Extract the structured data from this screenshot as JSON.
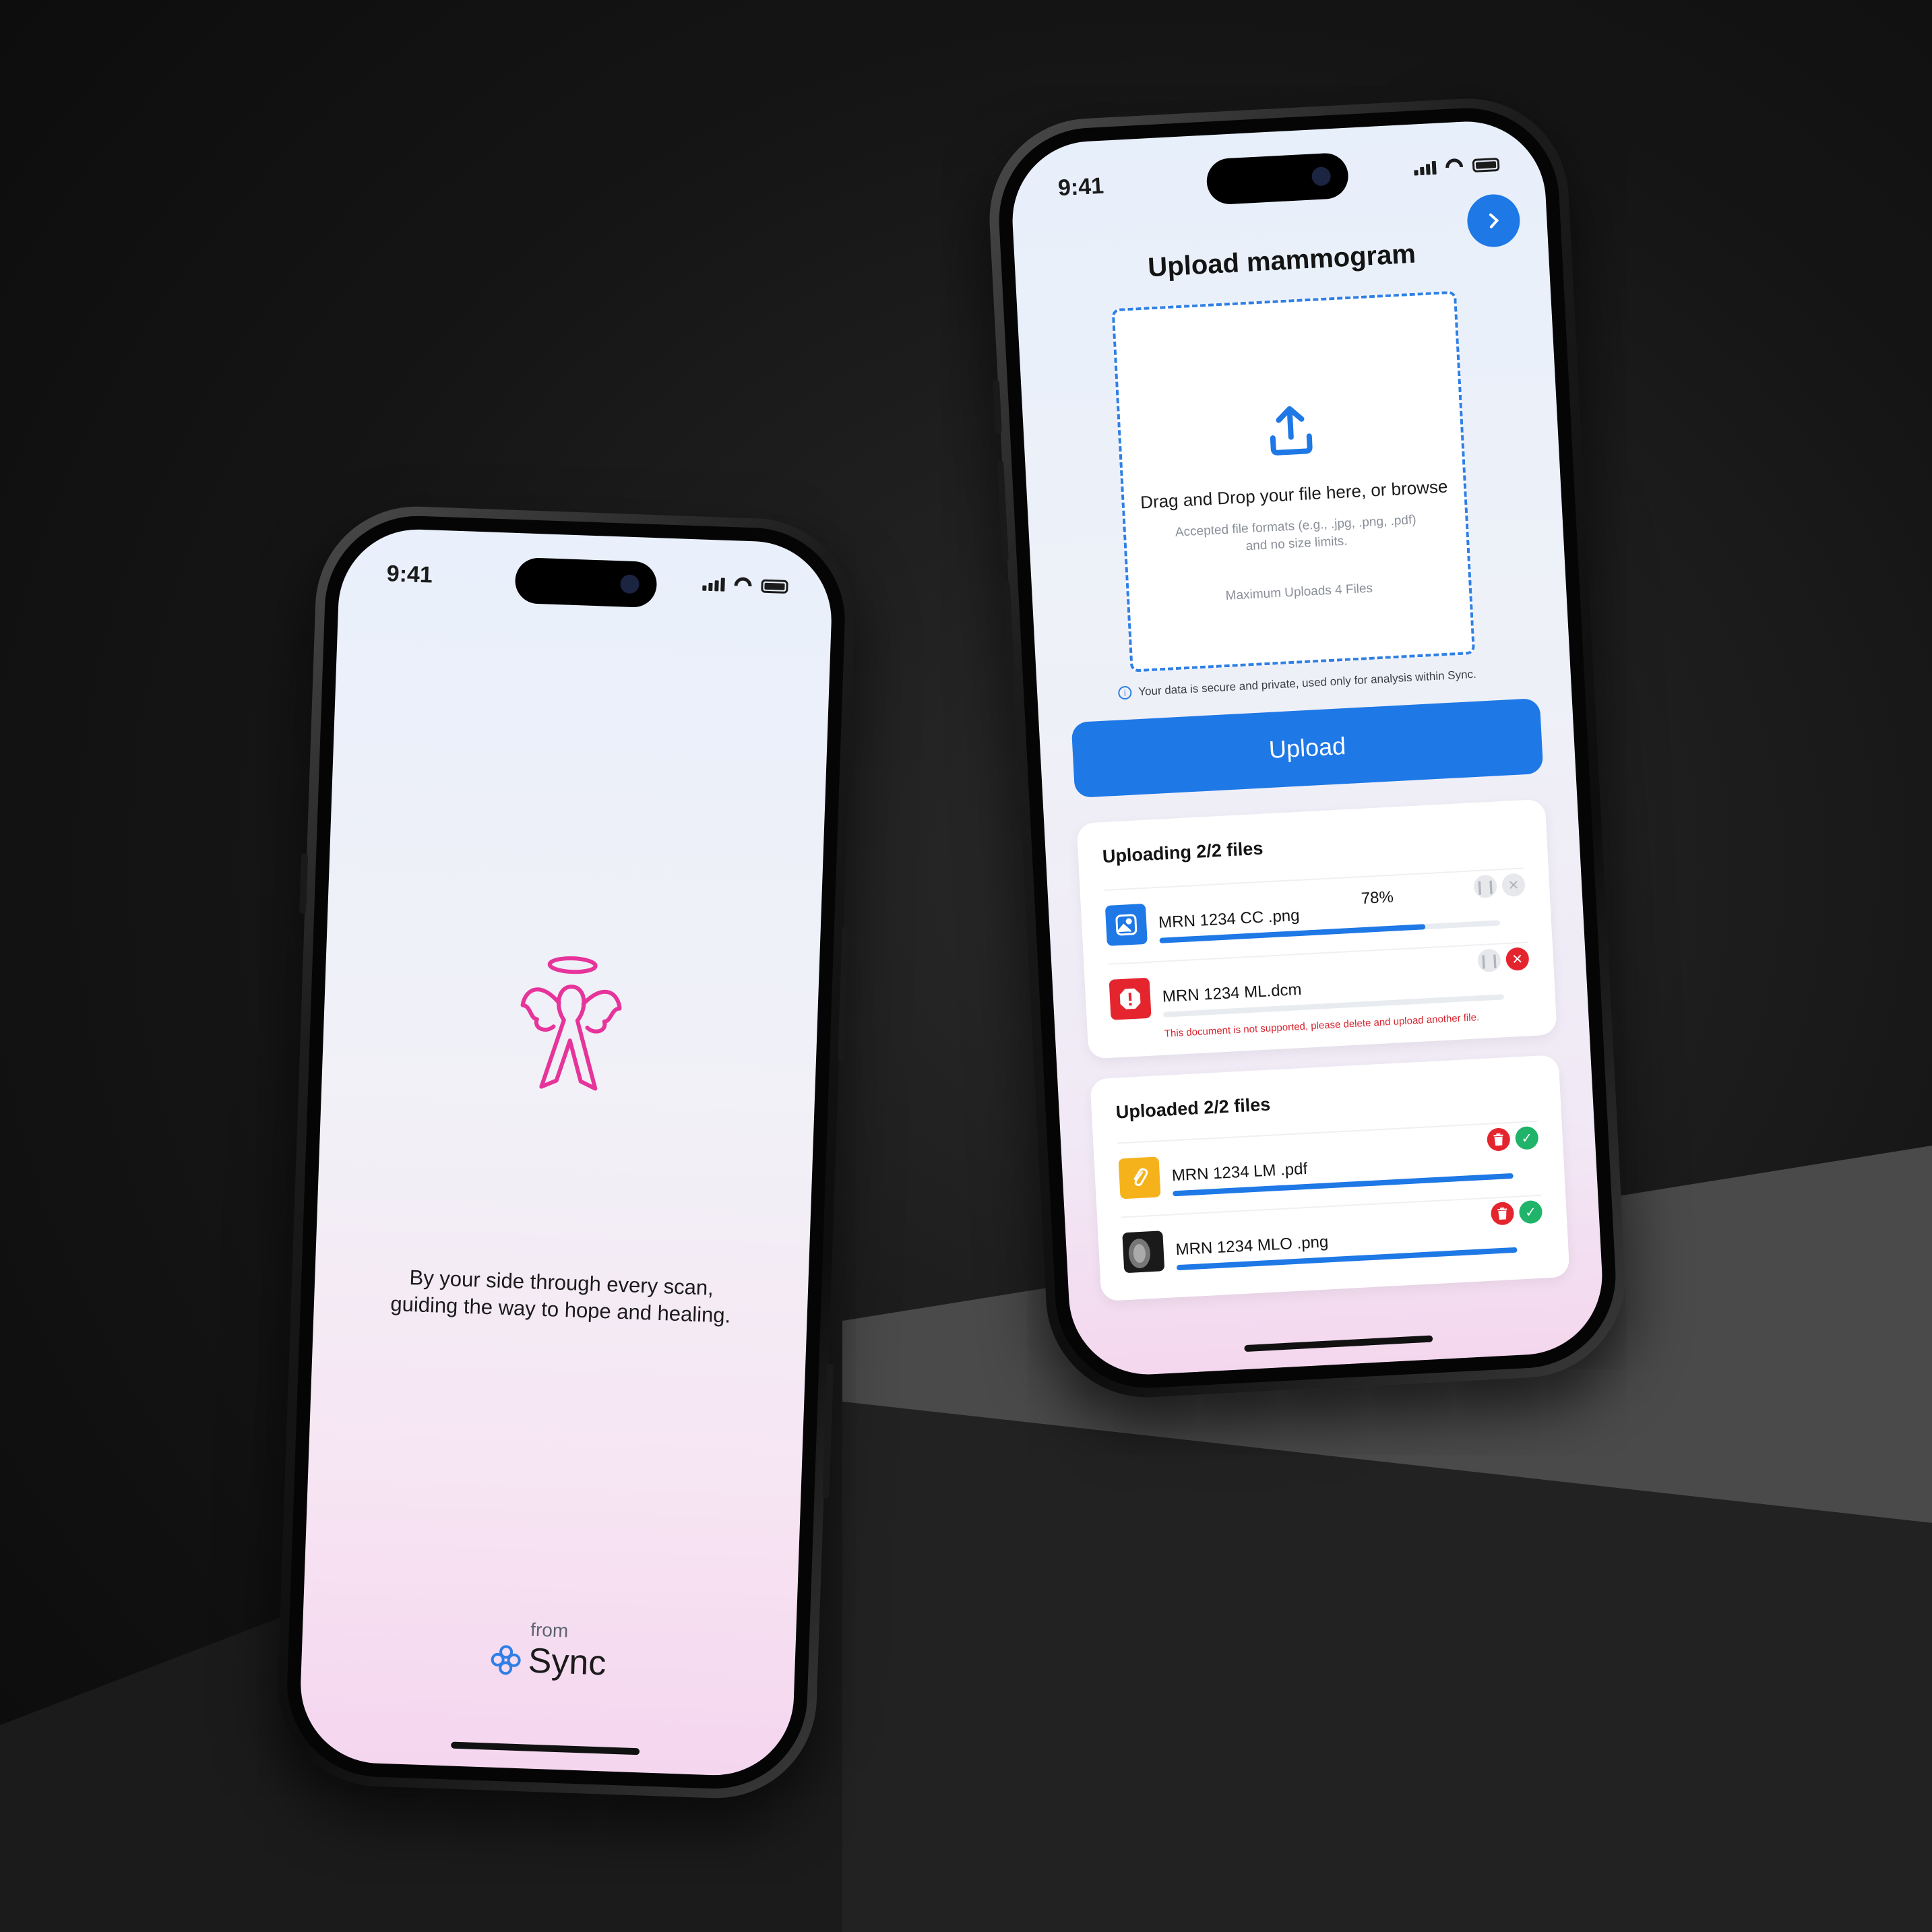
{
  "left_phone": {
    "time": "9:41",
    "tagline_line1": "By your side through every scan,",
    "tagline_line2": "guiding the way to hope and healing.",
    "brand_from": "from",
    "brand_name": "Sync",
    "ribbon_color": "#e6349b",
    "ribbon_icon": "angel-ribbon-icon"
  },
  "right_phone": {
    "time": "9:41",
    "title": "Upload mammogram",
    "next_icon": "chevron-right-icon",
    "dropzone": {
      "main": "Drag and Drop your file here, or browse",
      "formats_line1": "Accepted file formats (e.g., .jpg, .png, .pdf)",
      "formats_line2": "and no size limits.",
      "max": "Maximum Uploads 4 Files"
    },
    "privacy": "Your data is secure and private, used only for analysis within Sync.",
    "upload_label": "Upload",
    "uploading": {
      "title": "Uploading 2/2 files",
      "files": [
        {
          "name": "MRN 1234 CC .png",
          "percent": "78%",
          "progress": 0.78,
          "thumb": "image-icon"
        },
        {
          "name": "MRN 1234 ML.dcm",
          "error": "This document is not supported, please delete and upload another file.",
          "thumb": "error-icon"
        }
      ]
    },
    "uploaded": {
      "title": "Uploaded 2/2 files",
      "files": [
        {
          "name": "MRN 1234 LM .pdf",
          "progress": 1.0,
          "thumb": "paperclip-icon"
        },
        {
          "name": "MRN 1234 MLO .png",
          "progress": 1.0,
          "thumb": "mammogram-thumbnail"
        }
      ]
    },
    "accent_color": "#1e78e6",
    "error_color": "#e4252e",
    "success_color": "#20b36a"
  }
}
